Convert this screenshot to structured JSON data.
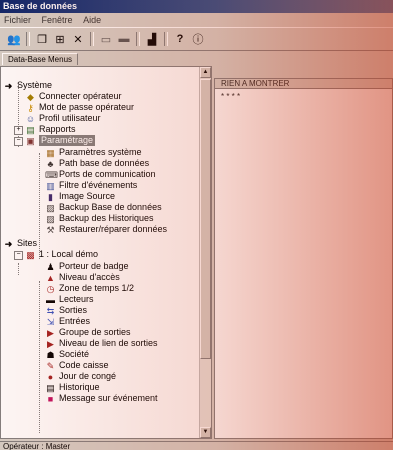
{
  "window": {
    "title": "Base de données"
  },
  "menu": [
    "Fichier",
    "Fenêtre",
    "Aide"
  ],
  "toolbar": [
    {
      "name": "users-icon",
      "glyph": "👥"
    },
    {
      "name": "new-icon",
      "glyph": "❐"
    },
    {
      "name": "properties-icon",
      "glyph": "⊞"
    },
    {
      "name": "delete-icon",
      "glyph": "✕"
    },
    {
      "name": "print-icon",
      "glyph": "▭"
    },
    {
      "name": "report-icon",
      "glyph": "▬"
    },
    {
      "name": "chart-icon",
      "glyph": "▟"
    },
    {
      "name": "help-icon",
      "glyph": "?"
    },
    {
      "name": "info-icon",
      "glyph": "ⓘ"
    }
  ],
  "tab": {
    "label": "Data-Base Menus"
  },
  "tree": {
    "systeme": {
      "label": "Système",
      "items": [
        "Connecter opérateur",
        "Mot de passe opérateur",
        "Profil utilisateur",
        "Rapports",
        "Paramétrage"
      ]
    },
    "parametrage_items": [
      "Paramètres système",
      "Path base de données",
      "Ports de communication",
      "Filtre d'événements",
      "Image Source",
      "Backup Base de données",
      "Backup des Historiques",
      "Restaurer/réparer données"
    ],
    "sites": {
      "label": "Sites",
      "site": "1 : Local démo"
    },
    "site_items": [
      "Porteur de badge",
      "Niveau d'accès",
      "Zone de temps 1/2",
      "Lecteurs",
      "Sorties",
      "Entrées",
      "Groupe de sorties",
      "Niveau de lien de sorties",
      "Société",
      "Code caisse",
      "Jour de congé",
      "Historique",
      "Message sur événement"
    ]
  },
  "list": {
    "header": "RIEN A MONTRER",
    "row": "* * * *"
  },
  "status": {
    "text": "Opérateur : Master"
  }
}
